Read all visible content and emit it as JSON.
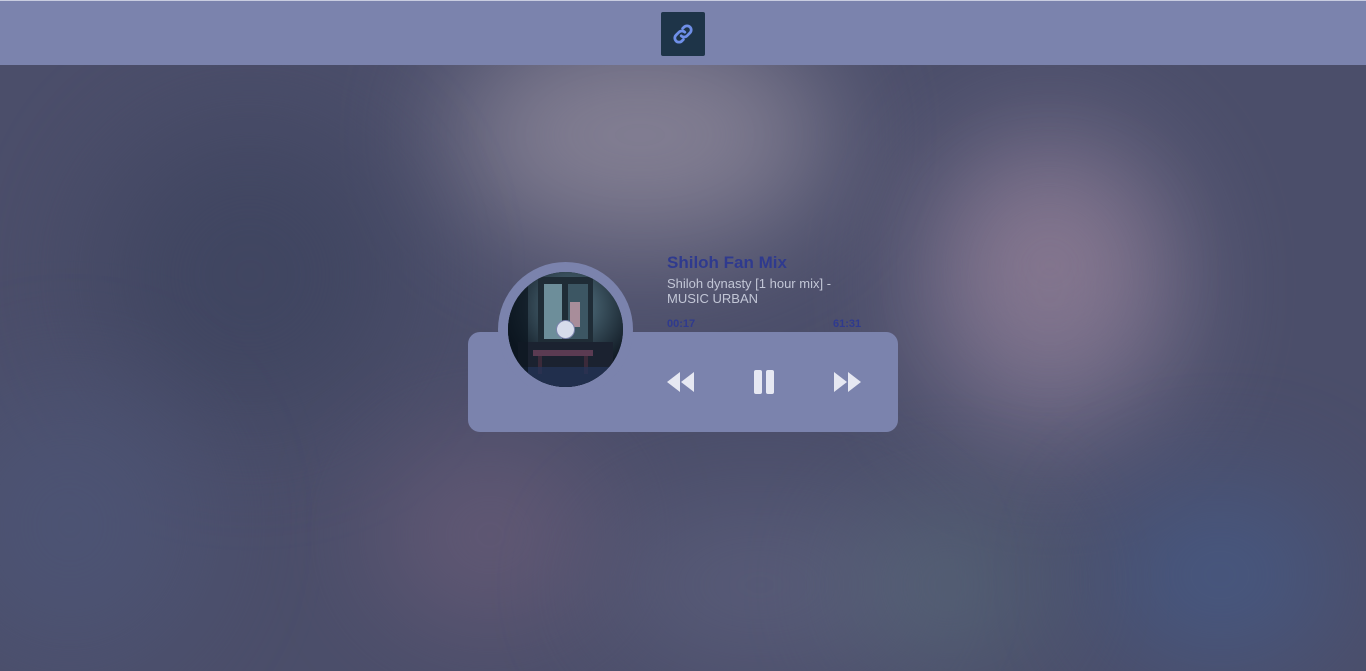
{
  "toolbar": {
    "link_icon": "link-icon",
    "link_button_color": "#1e3448"
  },
  "player": {
    "title": "Shiloh Fan Mix",
    "subtitle": "Shiloh dynasty [1 hour mix] - MUSIC URBAN",
    "current_time": "00:17",
    "total_time": "61:31",
    "state": "playing",
    "controls": {
      "rewind_icon": "rewind-icon",
      "pause_icon": "pause-icon",
      "forward_icon": "fast-forward-icon"
    },
    "accent_color": "#2f3a8e",
    "card_color": "#7b83ad"
  }
}
